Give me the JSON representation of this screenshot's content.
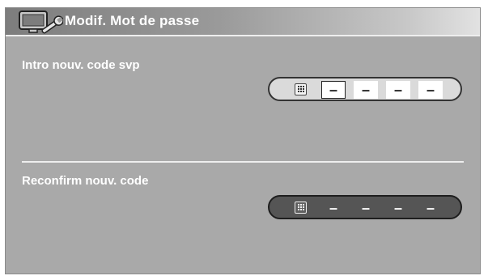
{
  "header": {
    "title": "Modif. Mot de passe",
    "icon": "monitor-wrench-icon"
  },
  "new_code": {
    "label": "Intro nouv. code svp",
    "digits": [
      "–",
      "–",
      "–",
      "–"
    ],
    "active_index": 0,
    "keypad_icon": "numeric-keypad-icon"
  },
  "confirm_code": {
    "label": "Reconfirm nouv. code",
    "digits": [
      "–",
      "–",
      "–",
      "–"
    ],
    "keypad_icon": "numeric-keypad-icon"
  }
}
